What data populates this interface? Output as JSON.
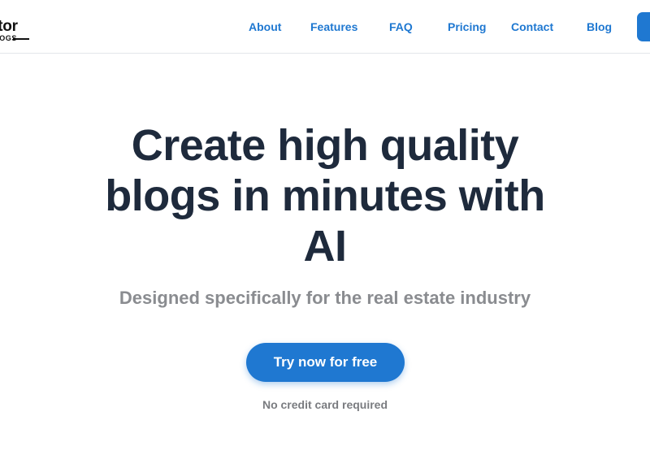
{
  "logo": {
    "line1": "altor",
    "line2": "BLOGS"
  },
  "nav": {
    "about": "About",
    "features": "Features",
    "faq": "FAQ",
    "pricing": "Pricing",
    "contact": "Contact",
    "blog": "Blog"
  },
  "hero": {
    "title_line1": "Create high quality",
    "title_line2": "blogs in minutes with",
    "title_line3": "AI",
    "subtitle": "Designed specifically for the real estate industry",
    "cta_label": "Try now for free",
    "note": "No credit card required"
  },
  "colors": {
    "accent": "#1f78d1",
    "heading": "#1e2a3c",
    "muted": "#8a8c90"
  }
}
